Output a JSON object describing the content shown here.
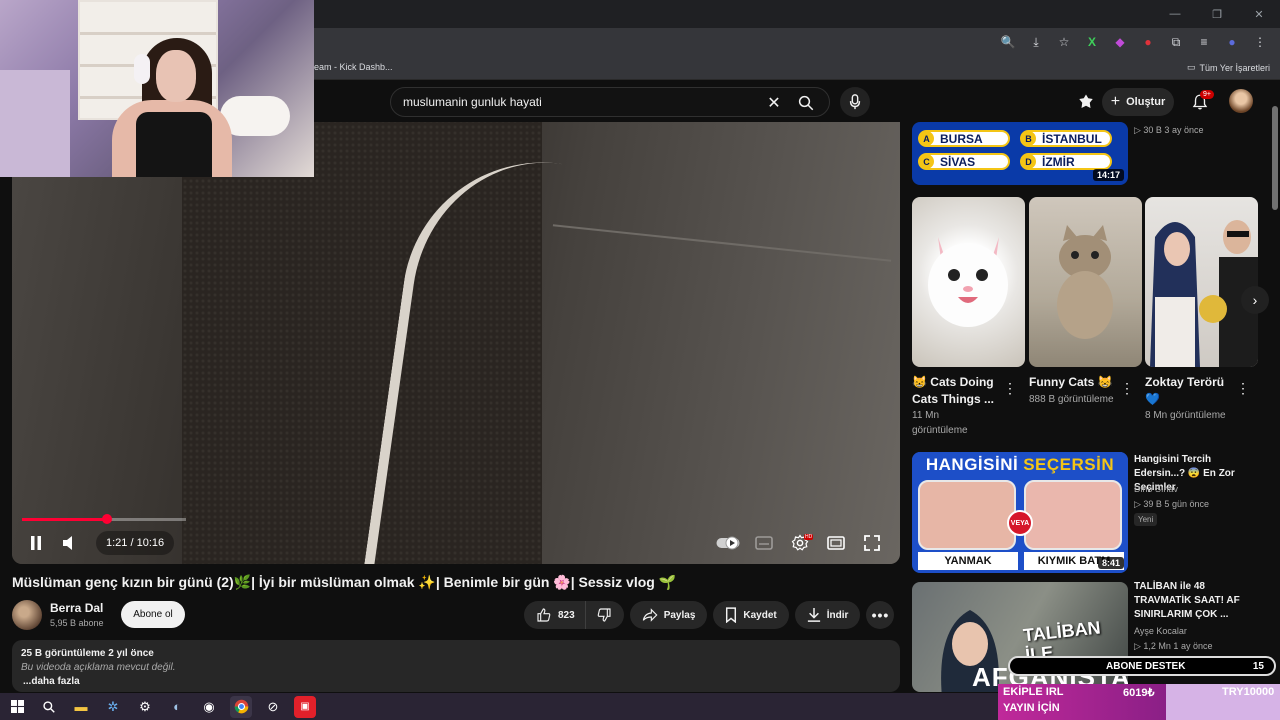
{
  "browser": {
    "bookmark_kick": "eam - Kick Dashb...",
    "bookmark_other": "Tüm Yer İşaretleri",
    "window_controls": [
      "—",
      "❐",
      "✕"
    ]
  },
  "header": {
    "search_query": "muslumanin gunluk hayati",
    "create_label": "Oluştur",
    "notif_count": "9+"
  },
  "player": {
    "time": "1:21 / 10:16",
    "progress_fraction": 0.13,
    "buffered_fraction": 0.185,
    "hd_badge": "HD"
  },
  "video": {
    "title": "Müslüman genç kızın bir günü (2)🌿| İyi bir müslüman olmak ✨| Benimle bir gün 🌸| Sessiz vlog 🌱",
    "channel": "Berra Dal",
    "subscribers": "5,95 B abone",
    "subscribe_label": "Abone ol",
    "likes": "823",
    "share_label": "Paylaş",
    "save_label": "Kaydet",
    "download_label": "İndir",
    "stats": "25 B görüntüleme  2 yıl önce",
    "description": "Bu videoda açıklama mevcut değil.",
    "more_label": "...daha fazla"
  },
  "sidebar": {
    "quiz": {
      "options": [
        {
          "letter": "A",
          "text": "BURSA"
        },
        {
          "letter": "B",
          "text": "İSTANBUL"
        },
        {
          "letter": "C",
          "text": "SİVAS"
        },
        {
          "letter": "D",
          "text": "İZMİR"
        }
      ],
      "duration": "14:17",
      "meta": "▷ 30 B  3 ay önce"
    },
    "shorts": [
      {
        "title": "😸 Cats Doing Cats Things ...",
        "views": "11 Mn görüntüleme"
      },
      {
        "title": "Funny Cats 😸",
        "views": "888 B görüntüleme"
      },
      {
        "title": "Zoktay Terörü 💙",
        "views": "8 Mn görüntüleme"
      }
    ],
    "choice": {
      "banner_a": "HANGİSİNİ",
      "banner_b": "SEÇERSİN",
      "left_label": "YANMAK",
      "right_label": "KIYMIK BATM",
      "veya": "VEYA",
      "duration": "8:41",
      "title": "Hangisini Tercih Edersin...? 😨 En Zor Seçimler",
      "channel": "Dino Sınav",
      "meta": "▷ 39 B  5 gün önce",
      "badge": "Yeni"
    },
    "taliban": {
      "thumb_text": "TALİBAN İLE",
      "thumb_text2": "AFGANİSTAN",
      "title": "TALİBAN ile 48 TRAVMATİK SAAT! AF SINIRLARIM ÇOK ...",
      "channel": "Ayşe Kocalar",
      "meta": "▷ 1,2 Mn  1 ay önce"
    }
  },
  "overlay": {
    "abone_label": "ABONE DESTEK",
    "abone_count": "15",
    "donate_line1": "EKİPLE IRL",
    "donate_line2": "YAYIN İÇİN",
    "donate_amount": "6019₺",
    "donate_goal": "TRY10000"
  },
  "colors": {
    "accent_red": "#ff0033",
    "background": "#0f0f0f",
    "chip": "#272727"
  }
}
